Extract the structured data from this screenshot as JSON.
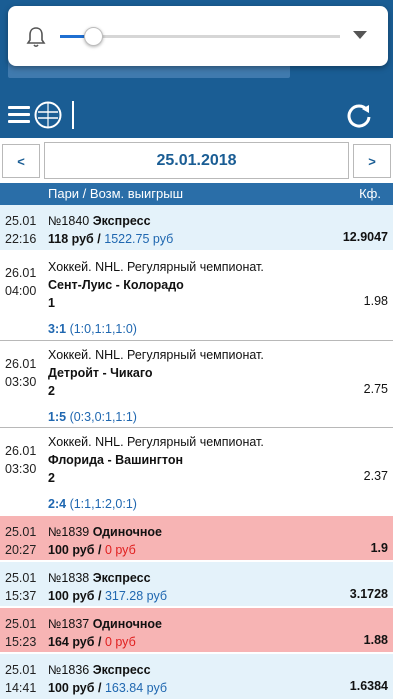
{
  "volume": {
    "level": 0.1
  },
  "header": {
    "date": "25.01.2018",
    "prev_label": "<",
    "next_label": ">"
  },
  "columns": {
    "bets": "Пари / Возм. выигрыш",
    "coef": "Кф."
  },
  "bets": [
    {
      "kind": "express",
      "day": "25.01",
      "time": "22:16",
      "num": "№1840",
      "type": "Экспресс",
      "stake": "118 руб",
      "win": "1522.75 руб",
      "coef": "12.9047"
    },
    {
      "kind": "event",
      "day": "26.01",
      "time": "04:00",
      "league": "Хоккей. NHL. Регулярный чемпионат.",
      "match": "Сент-Луис - Колорадо",
      "pick": "1",
      "coef": "1.98",
      "score": "3:1",
      "periods": "(1:0,1:1,1:0)"
    },
    {
      "kind": "event",
      "day": "26.01",
      "time": "03:30",
      "league": "Хоккей. NHL. Регулярный чемпионат.",
      "match": "Детройт - Чикаго",
      "pick": "2",
      "coef": "2.75",
      "score": "1:5",
      "periods": "(0:3,0:1,1:1)"
    },
    {
      "kind": "event",
      "day": "26.01",
      "time": "03:30",
      "league": "Хоккей. NHL. Регулярный чемпионат.",
      "match": "Флорида - Вашингтон",
      "pick": "2",
      "coef": "2.37",
      "score": "2:4",
      "periods": "(1:1,1:2,0:1)"
    },
    {
      "kind": "single",
      "day": "25.01",
      "time": "20:27",
      "num": "№1839",
      "type": "Одиночное",
      "stake": "100 руб",
      "win": "0 руб",
      "coef": "1.9"
    },
    {
      "kind": "express",
      "day": "25.01",
      "time": "15:37",
      "num": "№1838",
      "type": "Экспресс",
      "stake": "100 руб",
      "win": "317.28 руб",
      "coef": "3.1728"
    },
    {
      "kind": "single",
      "day": "25.01",
      "time": "15:23",
      "num": "№1837",
      "type": "Одиночное",
      "stake": "164 руб",
      "win": "0 руб",
      "coef": "1.88"
    },
    {
      "kind": "express",
      "day": "25.01",
      "time": "14:41",
      "num": "№1836",
      "type": "Экспресс",
      "stake": "100 руб",
      "win": "163.84 руб",
      "coef": "1.6384"
    }
  ],
  "colors": {
    "brand": "#1a5d94",
    "win": "#1f67b0",
    "loss": "#e02020",
    "express_bg": "#e4f2fa",
    "single_bg": "#f7b4b4"
  },
  "icons": {
    "menu": "hamburger-icon",
    "logo": "betcity-logo-icon",
    "refresh": "refresh-icon",
    "bell": "bell-icon",
    "expand": "chevron-down-icon"
  }
}
